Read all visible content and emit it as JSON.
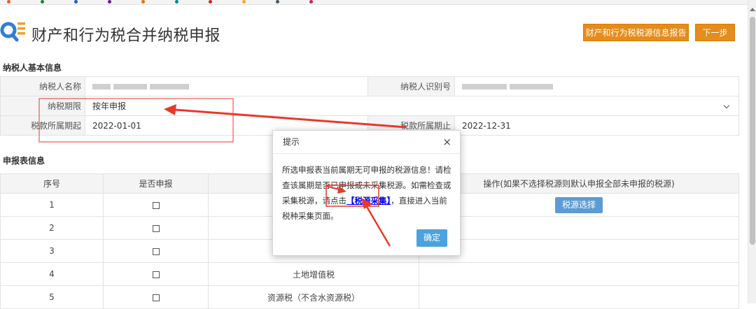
{
  "bookmarks": {
    "colors": [
      "#e05d36",
      "#2e7d32",
      "#1565c0",
      "#6a1b9a",
      "#ef6c00",
      "#00838f",
      "#c62828",
      "#f9a825",
      "#455a64",
      "#d81b60"
    ]
  },
  "header": {
    "title": "财产和行为税合并纳税申报",
    "report_button": "财产和行为税税源信息报告",
    "next_button": "下一步",
    "icon": "search-list-icon"
  },
  "basic_info": {
    "section_title": "纳税人基本信息",
    "taxpayer_name_label": "纳税人名称",
    "taxpayer_id_label": "纳税人识别号",
    "tax_period_label": "纳税期限",
    "tax_period_value": "按年申报",
    "period_start_label": "税款所属期起",
    "period_start_value": "2022-01-01",
    "period_end_label": "税款所属期止",
    "period_end_value": "2022-12-31"
  },
  "declaration": {
    "section_title": "申报表信息",
    "columns": [
      "序号",
      "是否申报",
      "",
      "操作(如果不选择税源则默认申报全部未申报的税源)"
    ],
    "rows": [
      {
        "no": "1",
        "tax": "",
        "action": "税源选择"
      },
      {
        "no": "2",
        "tax": "",
        "action": ""
      },
      {
        "no": "3",
        "tax": "",
        "action": ""
      },
      {
        "no": "4",
        "tax": "土地增值税",
        "action": ""
      },
      {
        "no": "5",
        "tax": "资源税（不含水资源税）",
        "action": ""
      }
    ]
  },
  "dialog": {
    "title": "提示",
    "close": "×",
    "text_1": "所选申报表当前属期无可申报的税源信息！请检查该属期是否已申报或未采集税源。如需检查或采集税源，请点击",
    "link": "【税源采集】",
    "text_2": "，直接进入当前税种采集页面。",
    "ok_button": "确定"
  },
  "annotation": {
    "color": "#e8392a"
  }
}
